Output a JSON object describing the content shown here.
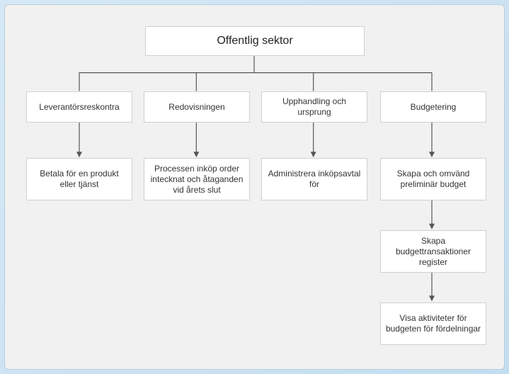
{
  "diagram": {
    "root": "Offentlig sektor",
    "cols": [
      {
        "head": "Leverantörsreskontra",
        "items": [
          "Betala för en produkt eller tjänst"
        ]
      },
      {
        "head": "Redovisningen",
        "items": [
          "Processen inköp order intecknat och åtaganden vid årets slut"
        ]
      },
      {
        "head": "Upphandling och ursprung",
        "items": [
          "Administrera inköpsavtal för"
        ]
      },
      {
        "head": "Budgetering",
        "items": [
          "Skapa och omvänd preliminär budget",
          "Skapa budgettransaktioner register",
          "Visa aktiviteter för budgeten för fördelningar"
        ]
      }
    ]
  }
}
